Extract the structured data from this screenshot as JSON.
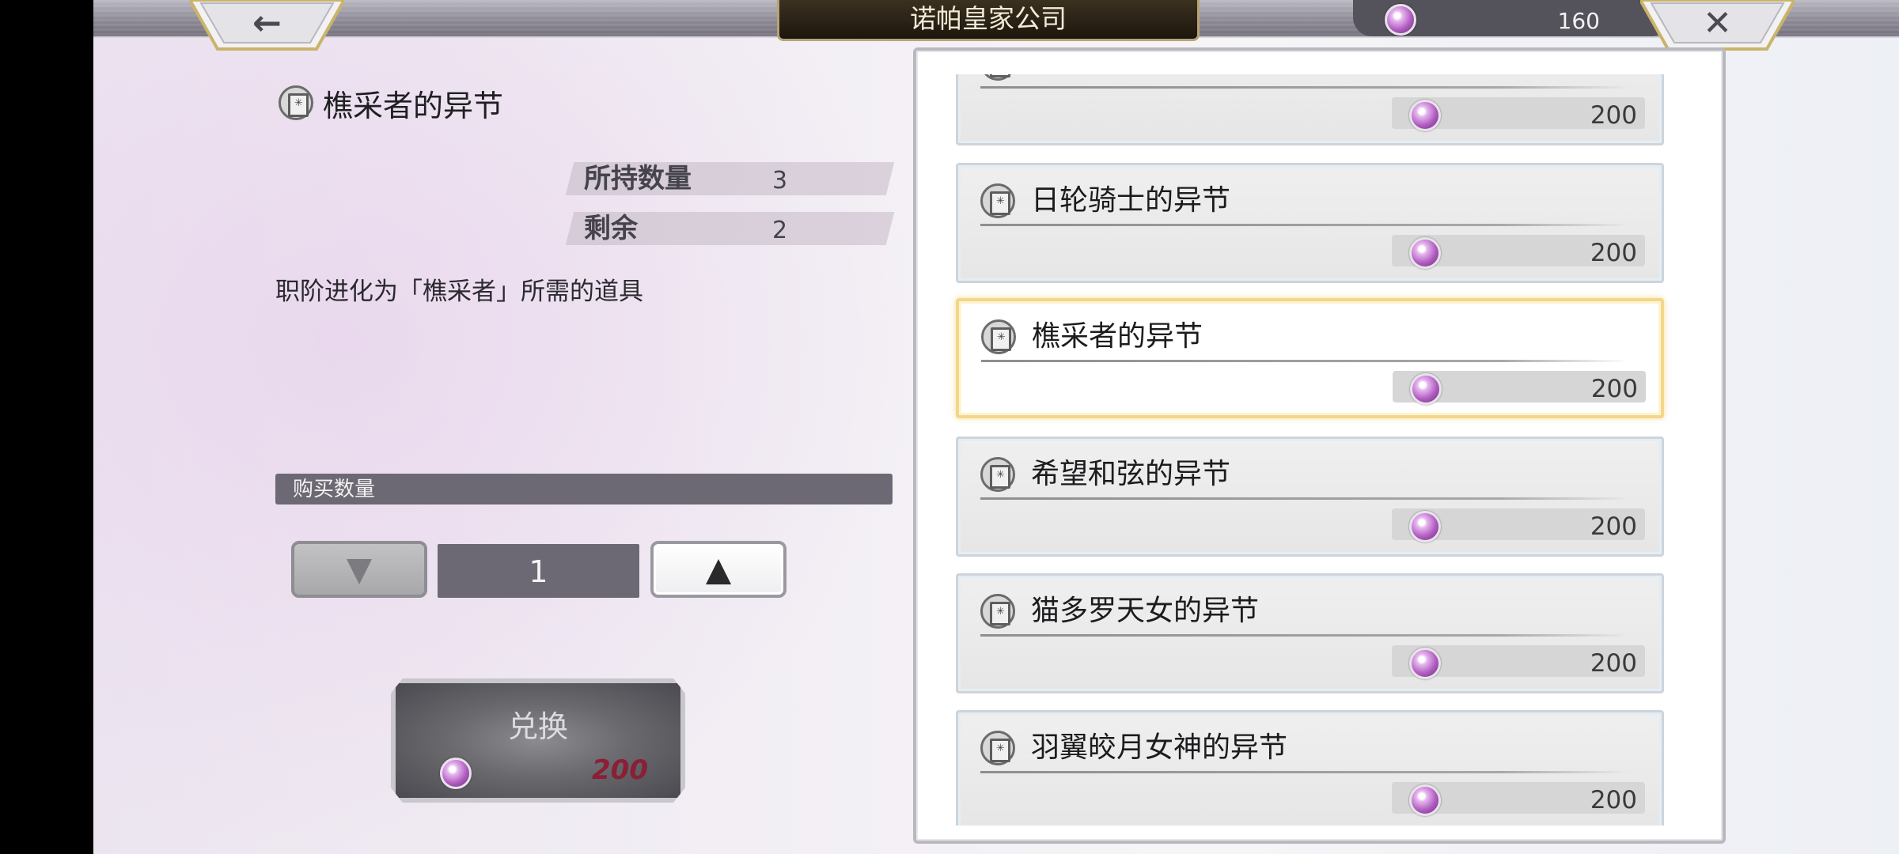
{
  "header": {
    "title": "诺帕皇家公司",
    "back_icon": "←",
    "close_icon": "✕",
    "currency_amount": "160"
  },
  "detail": {
    "item_name": "樵采者的异节",
    "owned_label": "所持数量",
    "owned_value": "3",
    "remaining_label": "剩余",
    "remaining_value": "2",
    "description": "职阶进化为「樵采者」所需的道具",
    "quantity_label": "购买数量",
    "quantity_value": "1",
    "decrease_icon": "▼",
    "increase_icon": "▲",
    "exchange_label": "兑换",
    "exchange_cost": "200"
  },
  "list": {
    "items": [
      {
        "name": "",
        "price": "200"
      },
      {
        "name": "日轮骑士的异节",
        "price": "200"
      },
      {
        "name": "樵采者的异节",
        "price": "200",
        "selected": true
      },
      {
        "name": "希望和弦的异节",
        "price": "200"
      },
      {
        "name": "猫多罗天女的异节",
        "price": "200"
      },
      {
        "name": "羽翼皎月女神的异节",
        "price": "200"
      }
    ]
  },
  "colors": {
    "accent_selected": "#f3d68a",
    "title_plate": "#1c160d",
    "panel_dark": "#6d6974",
    "exchange_cost": "#8a1f35"
  }
}
